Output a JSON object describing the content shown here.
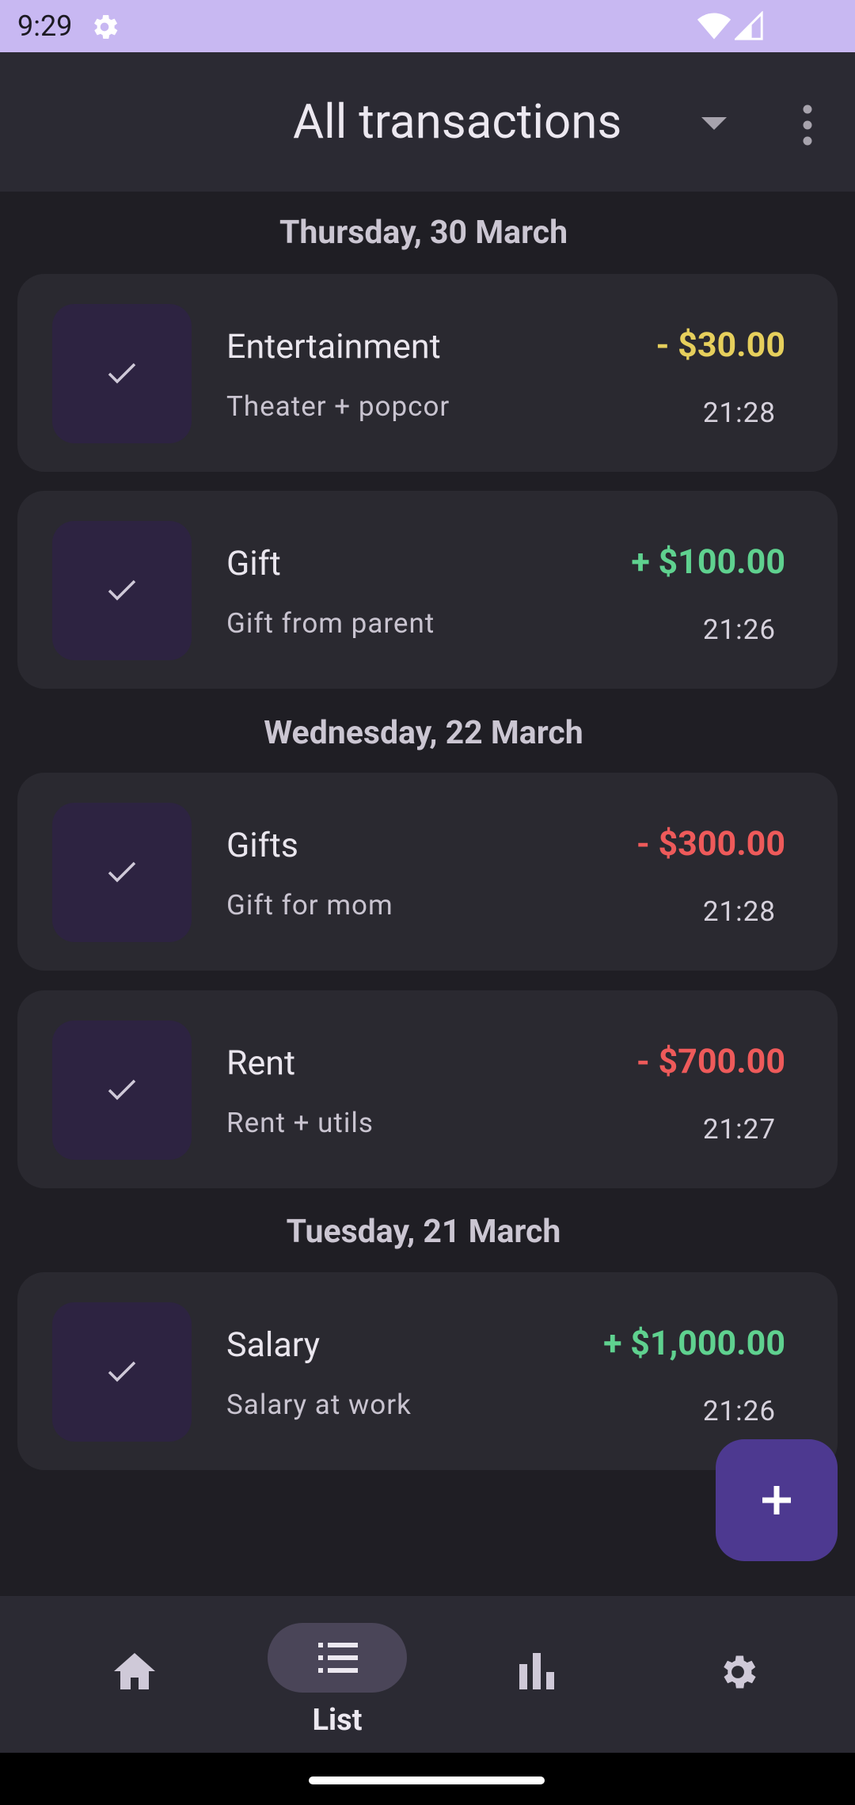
{
  "status_bar": {
    "time": "9:29",
    "icons": [
      "gear-icon",
      "wifi-icon",
      "signal-icon"
    ]
  },
  "app_bar": {
    "title": "All transactions",
    "dropdown_icon": "arrow-drop-down-icon",
    "menu_icon": "more-vert-icon"
  },
  "groups": [
    {
      "date": "Thursday, 30 March",
      "transactions": [
        {
          "category": "Entertainment",
          "note": "Theater + popcor",
          "amount": "- $30.00",
          "time": "21:28",
          "amount_color": "#e6cf5c",
          "icon": "check-icon"
        },
        {
          "category": "Gift",
          "note": "Gift from parent",
          "amount": "+ $100.00",
          "time": "21:26",
          "amount_color": "#5fd18f",
          "icon": "check-icon"
        }
      ]
    },
    {
      "date": "Wednesday, 22 March",
      "transactions": [
        {
          "category": "Gifts",
          "note": "Gift for mom",
          "amount": "- $300.00",
          "time": "21:28",
          "amount_color": "#ee5a5a",
          "icon": "check-icon"
        },
        {
          "category": "Rent",
          "note": "Rent + utils",
          "amount": "- $700.00",
          "time": "21:27",
          "amount_color": "#ee5a5a",
          "icon": "check-icon"
        }
      ]
    },
    {
      "date": "Tuesday, 21 March",
      "transactions": [
        {
          "category": "Salary",
          "note": "Salary at work",
          "amount": "+ $1,000.00",
          "time": "21:26",
          "amount_color": "#5fd18f",
          "icon": "check-icon"
        }
      ]
    }
  ],
  "fab": {
    "icon": "plus-icon"
  },
  "bottom_nav": {
    "items": [
      {
        "icon": "home-icon",
        "label": "",
        "selected": false
      },
      {
        "icon": "list-icon",
        "label": "List",
        "selected": true
      },
      {
        "icon": "bar-chart-icon",
        "label": "",
        "selected": false
      },
      {
        "icon": "settings-icon",
        "label": "",
        "selected": false
      }
    ]
  },
  "colors": {
    "background": "#1f1e24",
    "surface": "#2a2930",
    "accent": "#4d3990",
    "status_bar": "#c8b8f2",
    "income": "#5fd18f",
    "expense": "#ee5a5a",
    "expense_small": "#e6cf5c"
  }
}
